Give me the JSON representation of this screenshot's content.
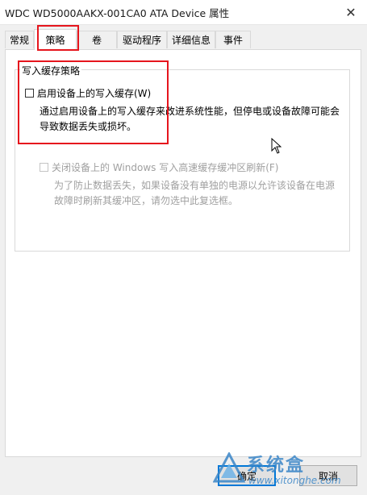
{
  "window": {
    "title": "WDC WD5000AAKX-001CA0 ATA Device 属性",
    "close_glyph": "✕"
  },
  "tabs": [
    {
      "label": "常规"
    },
    {
      "label": "策略"
    },
    {
      "label": "卷"
    },
    {
      "label": "驱动程序"
    },
    {
      "label": "详细信息"
    },
    {
      "label": "事件"
    }
  ],
  "active_tab": "策略",
  "policy": {
    "group_title": "写入缓存策略",
    "enable_cache_label": "启用设备上的写入缓存(W)",
    "enable_cache_checked": false,
    "enable_cache_desc_line1": "通过启用设备上的写入缓存来改进系统性能，但停电或设备故障可能会",
    "enable_cache_desc_line2": "导致数据丢失或损坏。",
    "flush_label": "关闭设备上的 Windows 写入高速缓存缓冲区刷新(F)",
    "flush_checked": false,
    "flush_enabled": false,
    "flush_desc_line1": "为了防止数据丢失，如果设备没有单独的电源以允许该设备在电源",
    "flush_desc_line2": "故障时刷新其缓冲区，请勿选中此复选框。"
  },
  "buttons": {
    "ok": "确定",
    "cancel": "取消"
  },
  "watermark": {
    "name": "系统盒",
    "url": "www.xitonghe.com"
  },
  "colors": {
    "highlight_red": "#e6151d",
    "accent_blue": "#0078d7",
    "disabled_text": "#a0a0a0"
  }
}
